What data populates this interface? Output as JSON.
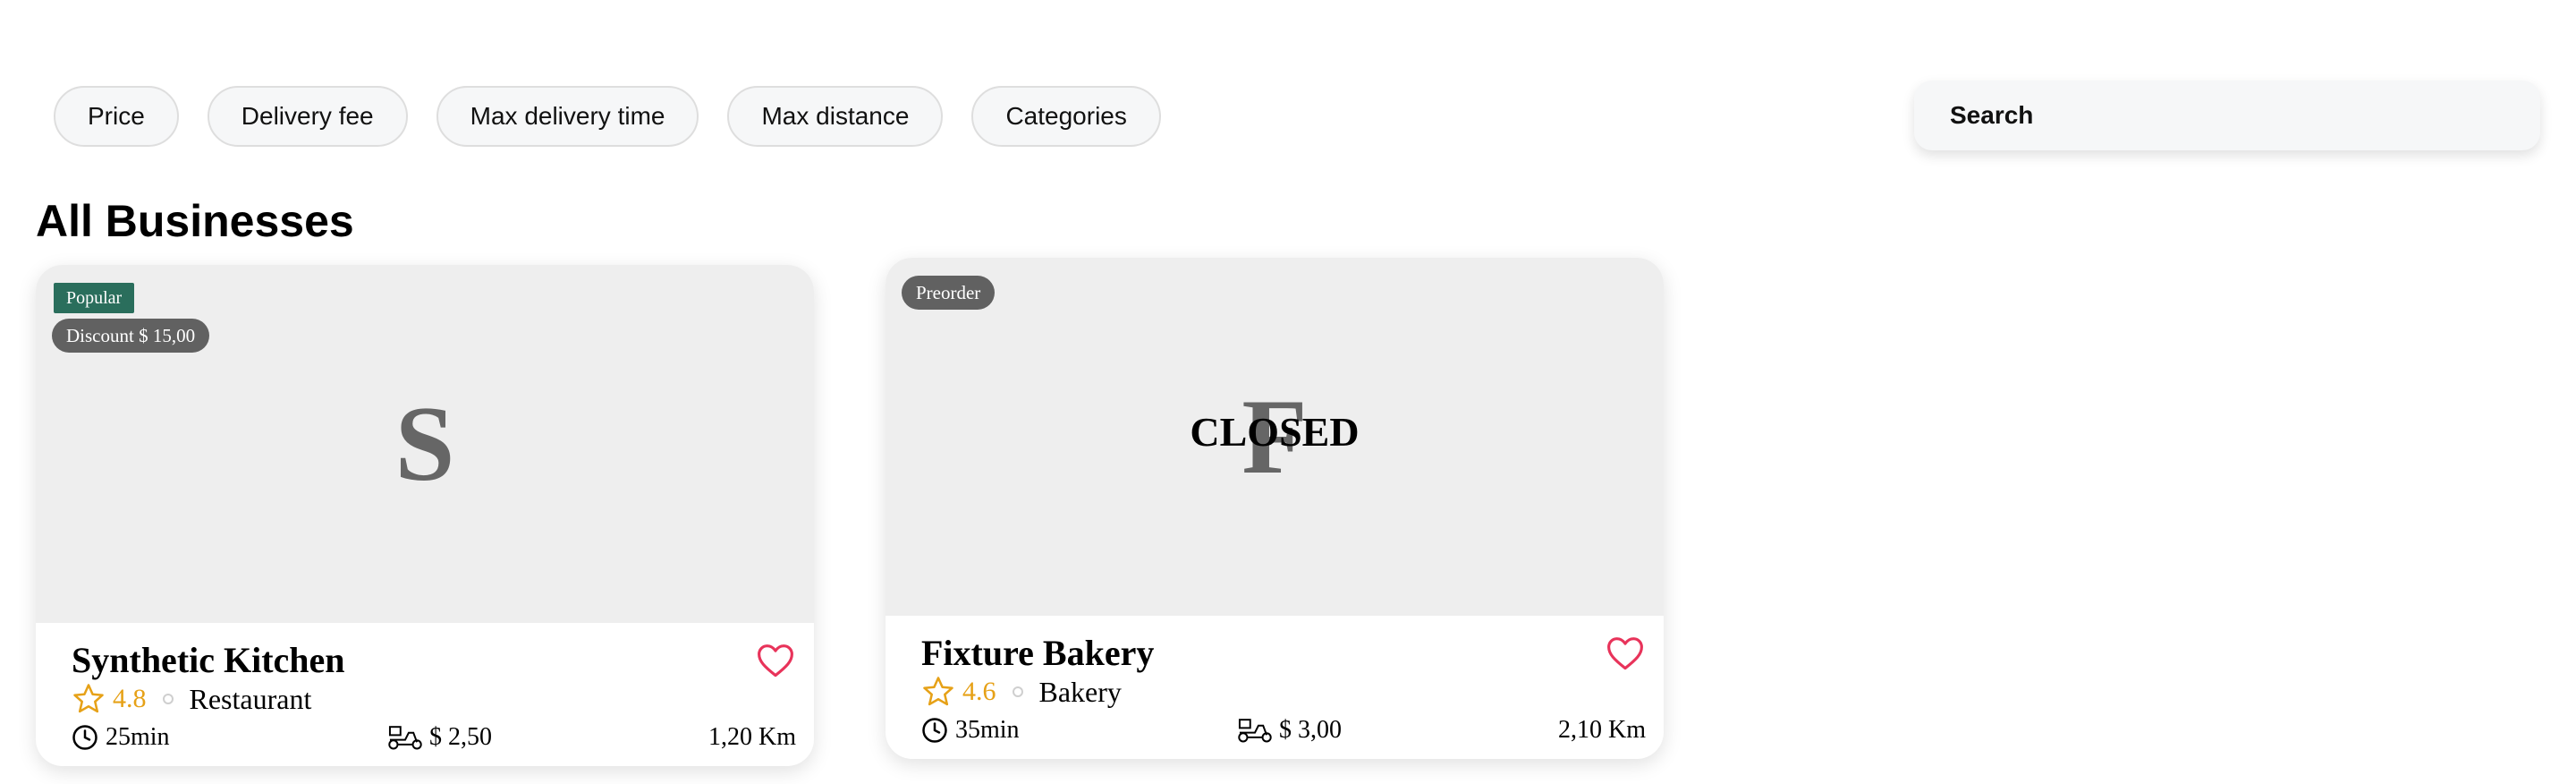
{
  "filters": [
    {
      "label": "Price"
    },
    {
      "label": "Delivery fee"
    },
    {
      "label": "Max delivery time"
    },
    {
      "label": "Max distance"
    },
    {
      "label": "Categories"
    }
  ],
  "search": {
    "label": "Search"
  },
  "section": {
    "title": "All Businesses"
  },
  "businesses": [
    {
      "initial": "S",
      "badge_top": "Popular",
      "badge_pill": "Discount $ 15,00",
      "closed_text": "",
      "name": "Synthetic Kitchen",
      "rating": "4.8",
      "category": "Restaurant",
      "delivery_time": "25min",
      "delivery_fee": "$ 2,50",
      "distance": "1,20 Km"
    },
    {
      "initial": "F",
      "badge_top": "",
      "badge_pill": "Preorder",
      "closed_text": "CLOSED",
      "name": "Fixture Bakery",
      "rating": "4.6",
      "category": "Bakery",
      "delivery_time": "35min",
      "delivery_fee": "$ 3,00",
      "distance": "2,10 Km"
    }
  ],
  "icons": {
    "star": "star-outline-icon",
    "heart": "heart-outline-icon",
    "clock": "clock-icon",
    "delivery": "delivery-scooter-icon"
  },
  "colors": {
    "popular_badge": "#2a6e5c",
    "pill_badge": "#616161",
    "rating": "#e6a117",
    "heart": "#e8335a"
  }
}
